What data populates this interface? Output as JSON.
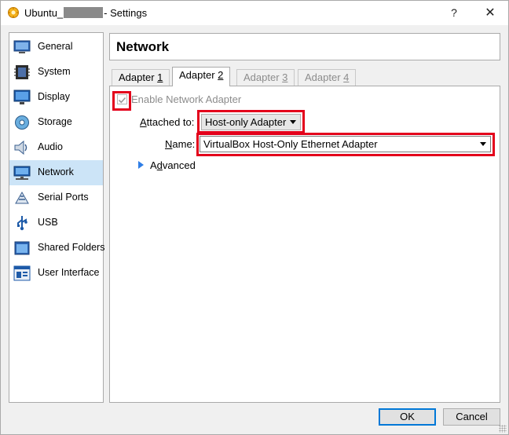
{
  "window": {
    "title_prefix": "Ubuntu_",
    "title_suffix": "- Settings",
    "help_glyph": "?",
    "close_glyph": "✕"
  },
  "sidebar": {
    "items": [
      {
        "label": "General",
        "icon": "general-icon"
      },
      {
        "label": "System",
        "icon": "system-icon"
      },
      {
        "label": "Display",
        "icon": "display-icon"
      },
      {
        "label": "Storage",
        "icon": "storage-icon"
      },
      {
        "label": "Audio",
        "icon": "audio-icon"
      },
      {
        "label": "Network",
        "icon": "network-icon",
        "selected": true
      },
      {
        "label": "Serial Ports",
        "icon": "serial-ports-icon"
      },
      {
        "label": "USB",
        "icon": "usb-icon"
      },
      {
        "label": "Shared Folders",
        "icon": "shared-folders-icon"
      },
      {
        "label": "User Interface",
        "icon": "user-interface-icon"
      }
    ]
  },
  "page": {
    "title": "Network"
  },
  "tabs": [
    {
      "label": "Adapter ",
      "mnemonic": "1",
      "state": "normal"
    },
    {
      "label": "Adapter ",
      "mnemonic": "2",
      "state": "active"
    },
    {
      "label": "Adapter ",
      "mnemonic": "3",
      "state": "disabled"
    },
    {
      "label": "Adapter ",
      "mnemonic": "4",
      "state": "disabled"
    }
  ],
  "adapter": {
    "enable_label": "Enable Network Adapter",
    "enable_checked": true,
    "attached_label_mnemonic": "A",
    "attached_label_rest": "ttached to:",
    "attached_value": "Host-only Adapter",
    "name_label_mnemonic": "N",
    "name_label_rest": "ame:",
    "name_value": "VirtualBox Host-Only Ethernet Adapter",
    "advanced_mnemonic": "d",
    "advanced_prefix": "A",
    "advanced_rest": "vanced"
  },
  "buttons": {
    "ok": "OK",
    "cancel": "Cancel"
  },
  "colors": {
    "highlight": "#e3001b",
    "selection": "#cce4f7",
    "accent": "#0078d7"
  }
}
